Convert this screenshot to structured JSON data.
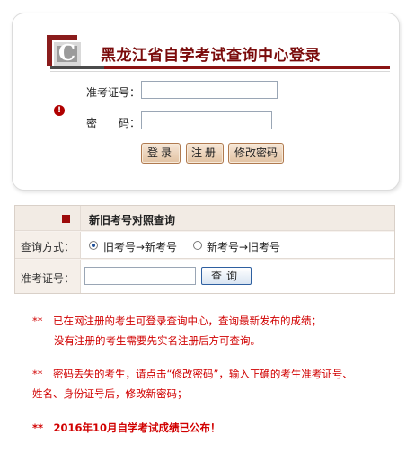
{
  "login": {
    "title": "黑龙江省自学考试查询中心登录",
    "exam_number_label": "准考证号：",
    "exam_number_value": "",
    "password_label": "密　　码：",
    "password_value": "",
    "login_button": "登录",
    "register_button": "注册",
    "change_password_button": "修改密码"
  },
  "query": {
    "header": "新旧考号对照查询",
    "method_label": "查询方式：",
    "options": [
      "旧考号→新考号",
      "新考号→旧考号"
    ],
    "selected_option": "旧考号→新考号",
    "number_label": "准考证号：",
    "number_value": "",
    "query_button": "查询"
  },
  "notices": {
    "line1": "**　已在网注册的考生可登录查询中心，查询最新发布的成绩；",
    "line2": "没有注册的考生需要先实名注册后方可查询。",
    "line3": "**　密码丢失的考生，请点击“修改密码”，输入正确的考生准考证号、",
    "line4": "姓名、身份证号后，修改新密码；",
    "line5": "**　2016年10月自学考试成绩已公布！"
  },
  "colors": {
    "title": "#7a0b0b",
    "accent": "#8a1414",
    "notice": "#d10000"
  },
  "icons": {
    "logo": "c-logo",
    "alert": "alert-icon",
    "header_marker": "red-square"
  }
}
